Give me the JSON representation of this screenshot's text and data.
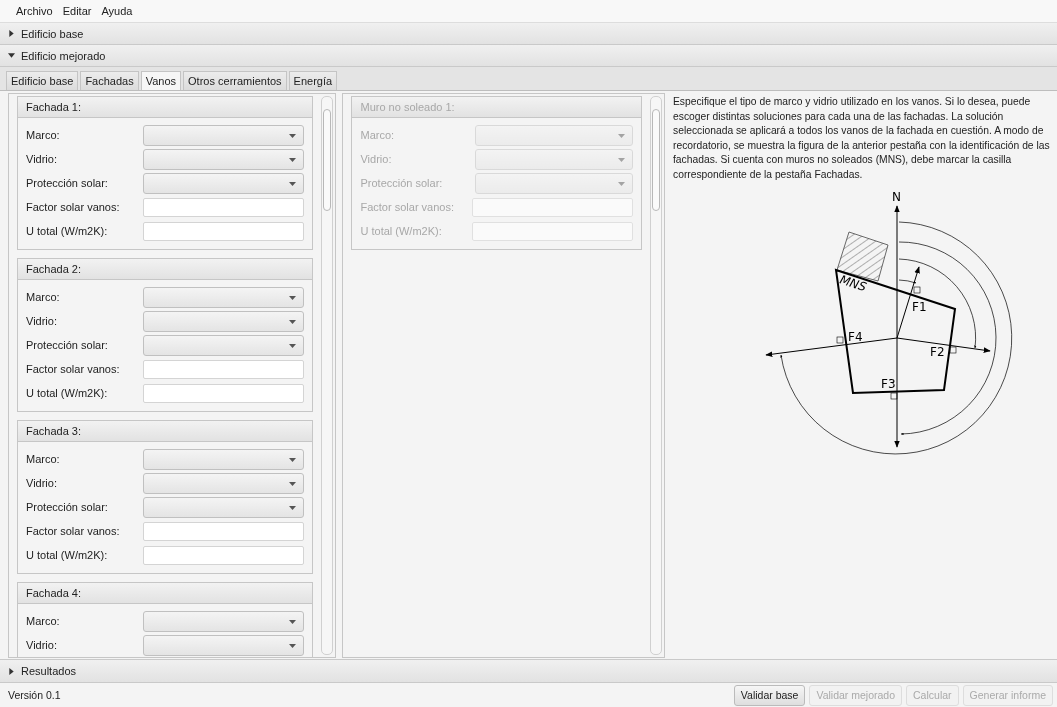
{
  "menu": [
    "Archivo",
    "Editar",
    "Ayuda"
  ],
  "accordion": [
    {
      "label": "Edificio base",
      "expanded": false
    },
    {
      "label": "Edificio mejorado",
      "expanded": true
    }
  ],
  "tabs": [
    {
      "label": "Edificio base",
      "selected": false
    },
    {
      "label": "Fachadas",
      "selected": false
    },
    {
      "label": "Vanos",
      "selected": true
    },
    {
      "label": "Otros cerramientos",
      "selected": false
    },
    {
      "label": "Energía",
      "selected": false
    }
  ],
  "facades": [
    {
      "title": "Fachada 1:",
      "disabled": false,
      "fields": [
        {
          "label": "Marco:",
          "kind": "select"
        },
        {
          "label": "Vidrio:",
          "kind": "select"
        },
        {
          "label": "Protección solar:",
          "kind": "select"
        },
        {
          "label": "Factor solar vanos:",
          "kind": "text"
        },
        {
          "label": "U total (W/m2K):",
          "kind": "text"
        }
      ]
    },
    {
      "title": "Fachada 2:",
      "disabled": false,
      "fields": [
        {
          "label": "Marco:",
          "kind": "select"
        },
        {
          "label": "Vidrio:",
          "kind": "select"
        },
        {
          "label": "Protección solar:",
          "kind": "select"
        },
        {
          "label": "Factor solar vanos:",
          "kind": "text"
        },
        {
          "label": "U total (W/m2K):",
          "kind": "text"
        }
      ]
    },
    {
      "title": "Fachada 3:",
      "disabled": false,
      "fields": [
        {
          "label": "Marco:",
          "kind": "select"
        },
        {
          "label": "Vidrio:",
          "kind": "select"
        },
        {
          "label": "Protección solar:",
          "kind": "select"
        },
        {
          "label": "Factor solar vanos:",
          "kind": "text"
        },
        {
          "label": "U total (W/m2K):",
          "kind": "text"
        }
      ]
    },
    {
      "title": "Fachada 4:",
      "disabled": false,
      "fields": [
        {
          "label": "Marco:",
          "kind": "select"
        },
        {
          "label": "Vidrio:",
          "kind": "select"
        }
      ]
    }
  ],
  "unsunned_walls": [
    {
      "title": "Muro no soleado 1:",
      "disabled": true,
      "fields": [
        {
          "label": "Marco:",
          "kind": "select"
        },
        {
          "label": "Vidrio:",
          "kind": "select"
        },
        {
          "label": "Protección solar:",
          "kind": "select"
        },
        {
          "label": "Factor solar vanos:",
          "kind": "text"
        },
        {
          "label": "U total (W/m2K):",
          "kind": "text"
        }
      ]
    }
  ],
  "description": "Especifique el tipo de marco y vidrio utilizado en los vanos. Si lo desea, puede escoger distintas soluciones para cada una de las fachadas. La solución seleccionada se aplicará a todos los vanos de la fachada en cuestión. A modo de recordatorio, se muestra la figura de la anterior pestaña con la identificación de las fachadas. Si cuenta con muros no soleados (MNS), debe marcar la casilla correspondiente de la pestaña Fachadas.",
  "diagram": {
    "north": "N",
    "wall": "MNS",
    "facades": [
      "F1",
      "F2",
      "F3",
      "F4"
    ]
  },
  "results": {
    "label": "Resultados",
    "expanded": false
  },
  "version": "Versión 0.1",
  "buttons": [
    {
      "label": "Validar base",
      "disabled": false
    },
    {
      "label": "Validar mejorado",
      "disabled": true
    },
    {
      "label": "Calcular",
      "disabled": true
    },
    {
      "label": "Generar informe",
      "disabled": true
    }
  ]
}
